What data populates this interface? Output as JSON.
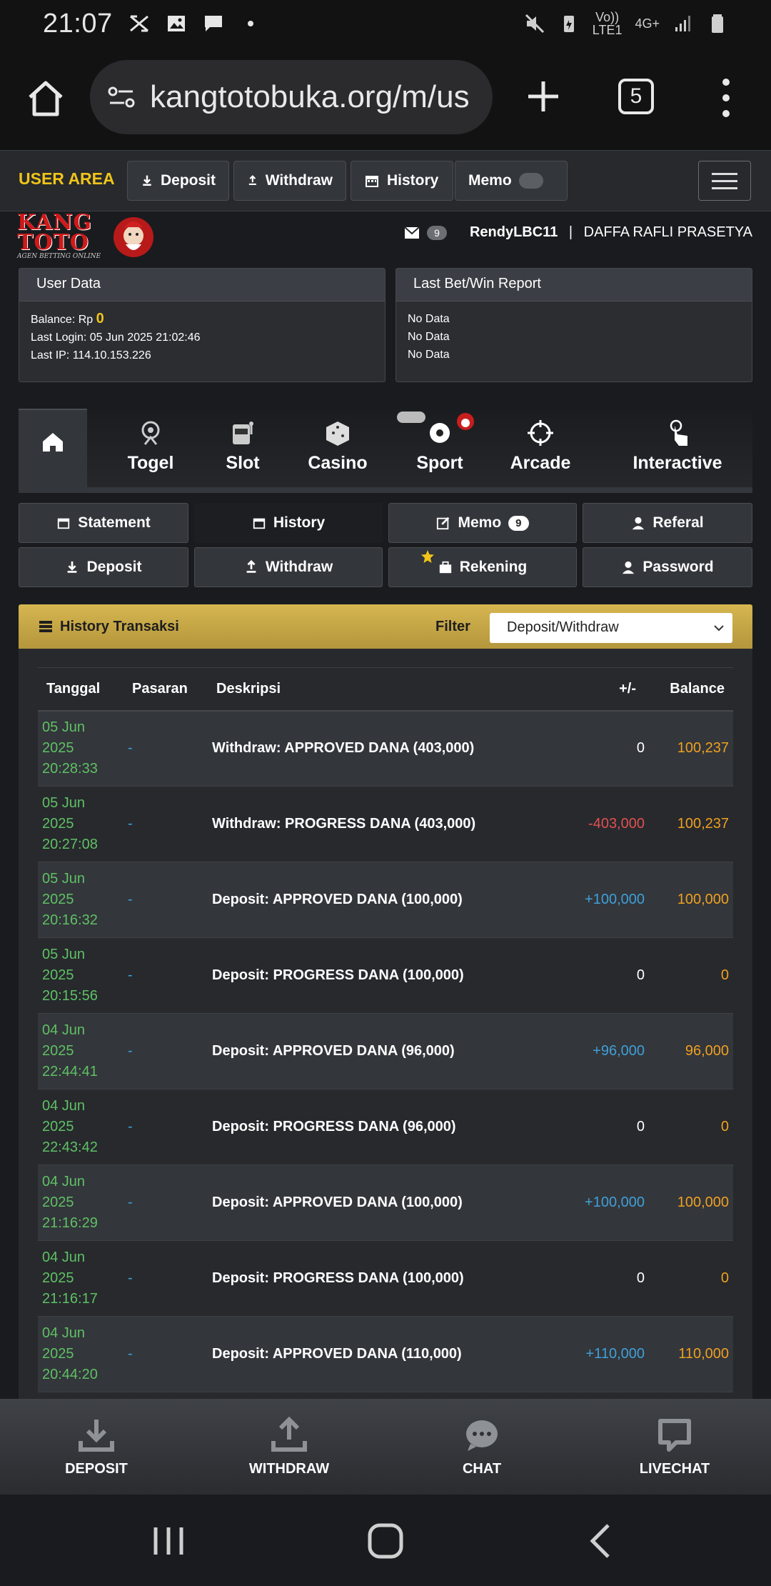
{
  "status_bar": {
    "time": "21:07",
    "network_label_1": "Vo))",
    "network_label_2": "LTE1",
    "network_type": "4G+"
  },
  "browser": {
    "url": "kangtotobuka.org/m/us",
    "tab_count": "5"
  },
  "topnav": {
    "user_area": "USER AREA",
    "deposit": "Deposit",
    "withdraw": "Withdraw",
    "history": "History",
    "memo": "Memo"
  },
  "header": {
    "logo_line1": "KANG",
    "logo_line2": "TOTO",
    "logo_tagline": "AGEN BETTING ONLINE",
    "mail_count": "9",
    "username": "RendyLBC11",
    "separator": " | ",
    "fullname": "DAFFA RAFLI PRASETYA"
  },
  "user_data": {
    "title": "User Data",
    "balance_label": "Balance: Rp ",
    "balance_value": "0",
    "last_login": "Last Login: 05 Jun 2025 21:02:46",
    "last_ip": "Last IP: 114.10.153.226"
  },
  "last_report": {
    "title": "Last Bet/Win Report",
    "lines": [
      "No Data",
      "No Data",
      "No Data"
    ]
  },
  "game_tabs": [
    "Togel",
    "Slot",
    "Casino",
    "Sport",
    "Arcade",
    "Interactive"
  ],
  "sub_menu": {
    "statement": "Statement",
    "history": "History",
    "memo": "Memo",
    "memo_count": "9",
    "referal": "Referal",
    "deposit": "Deposit",
    "withdraw": "Withdraw",
    "rekening": "Rekening",
    "password": "Password"
  },
  "history": {
    "title": "History Transaksi",
    "filter_label": "Filter",
    "filter_value": "Deposit/Withdraw",
    "columns": {
      "tanggal": "Tanggal",
      "pasaran": "Pasaran",
      "deskripsi": "Deskripsi",
      "amount": "+/-",
      "balance": "Balance"
    },
    "rows": [
      {
        "d1": "05 Jun",
        "d2": "2025",
        "d3": "20:28:33",
        "pasaran": "-",
        "desc": "Withdraw: APPROVED DANA (403,000)",
        "amount": "0",
        "amount_type": "zero",
        "balance": "100,237"
      },
      {
        "d1": "05 Jun",
        "d2": "2025",
        "d3": "20:27:08",
        "pasaran": "-",
        "desc": "Withdraw: PROGRESS DANA (403,000)",
        "amount": "-403,000",
        "amount_type": "neg",
        "balance": "100,237"
      },
      {
        "d1": "05 Jun",
        "d2": "2025",
        "d3": "20:16:32",
        "pasaran": "-",
        "desc": "Deposit: APPROVED DANA (100,000)",
        "amount": "+100,000",
        "amount_type": "pos",
        "balance": "100,000"
      },
      {
        "d1": "05 Jun",
        "d2": "2025",
        "d3": "20:15:56",
        "pasaran": "-",
        "desc": "Deposit: PROGRESS DANA (100,000)",
        "amount": "0",
        "amount_type": "zero",
        "balance": "0"
      },
      {
        "d1": "04 Jun",
        "d2": "2025",
        "d3": "22:44:41",
        "pasaran": "-",
        "desc": "Deposit: APPROVED DANA (96,000)",
        "amount": "+96,000",
        "amount_type": "pos",
        "balance": "96,000"
      },
      {
        "d1": "04 Jun",
        "d2": "2025",
        "d3": "22:43:42",
        "pasaran": "-",
        "desc": "Deposit: PROGRESS DANA (96,000)",
        "amount": "0",
        "amount_type": "zero",
        "balance": "0"
      },
      {
        "d1": "04 Jun",
        "d2": "2025",
        "d3": "21:16:29",
        "pasaran": "-",
        "desc": "Deposit: APPROVED DANA (100,000)",
        "amount": "+100,000",
        "amount_type": "pos",
        "balance": "100,000"
      },
      {
        "d1": "04 Jun",
        "d2": "2025",
        "d3": "21:16:17",
        "pasaran": "-",
        "desc": "Deposit: PROGRESS DANA (100,000)",
        "amount": "0",
        "amount_type": "zero",
        "balance": "0"
      },
      {
        "d1": "04 Jun",
        "d2": "2025",
        "d3": "20:44:20",
        "pasaran": "-",
        "desc": "Deposit: APPROVED DANA (110,000)",
        "amount": "+110,000",
        "amount_type": "pos",
        "balance": "110,000"
      }
    ]
  },
  "bottom_bar": [
    "DEPOSIT",
    "WITHDRAW",
    "CHAT",
    "LIVECHAT"
  ],
  "colors": {
    "accent_gold": "#f0c419",
    "positive": "#3fa0d8",
    "negative": "#e05050",
    "date_green": "#5fc064",
    "balance_orange": "#f0a020"
  }
}
